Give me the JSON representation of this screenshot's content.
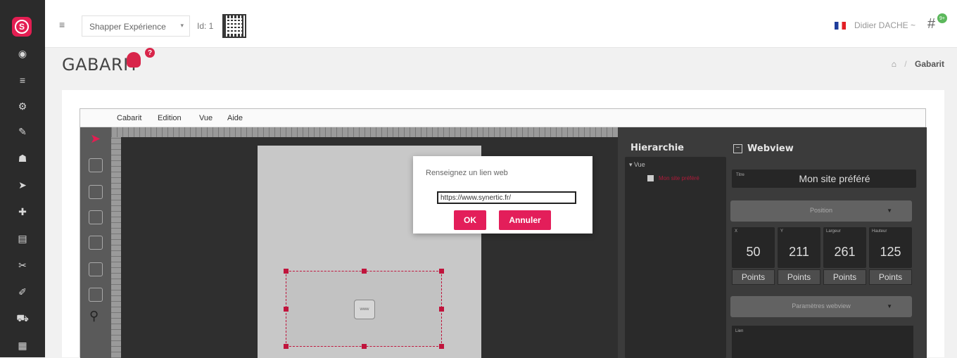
{
  "app": {
    "logo_letter": "S",
    "brand_color": "#e31e52"
  },
  "leftnav": {
    "icons": [
      "dashboard-icon",
      "list-icon",
      "settings-icon",
      "edit-icon",
      "users-icon",
      "send-icon",
      "puzzle-icon",
      "card-icon",
      "wrench-icon",
      "brush-icon",
      "cart-icon",
      "calendar-icon"
    ]
  },
  "topbar": {
    "project": "Shapper Expérience",
    "caret": "▾",
    "id_label": "Id: 1",
    "user": "Didier DACHE ~",
    "hash": "#",
    "badge": "9+"
  },
  "page": {
    "title": "GABARIT",
    "help": "?"
  },
  "breadcrumb": {
    "home": "⌂",
    "sep": "/",
    "current": "Gabarit"
  },
  "menu": {
    "items": [
      "Cabarit",
      "Edition",
      "Vue",
      "Aide"
    ]
  },
  "hierarchy": {
    "title": "Hierarchie",
    "root": "▾ Vue",
    "item": "Mon site préféré"
  },
  "webview": {
    "title": "Webview",
    "field_title_label": "Titre",
    "field_title_value": "Mon site préféré",
    "position_label": "Position",
    "params_label": "Paramètres webview",
    "lien_label": "Lien",
    "coords": [
      {
        "label": "X",
        "value": "50",
        "unit": "Points"
      },
      {
        "label": "Y",
        "value": "211",
        "unit": "Points"
      },
      {
        "label": "Largeur",
        "value": "261",
        "unit": "Points"
      },
      {
        "label": "Hauteur",
        "value": "125",
        "unit": "Points"
      }
    ]
  },
  "modal": {
    "prompt": "Renseignez un lien web",
    "url_value": "https://www.synertic.fr/",
    "ok_label": "OK",
    "cancel_label": "Annuler"
  },
  "canvas": {
    "web_icon_label": "www"
  }
}
